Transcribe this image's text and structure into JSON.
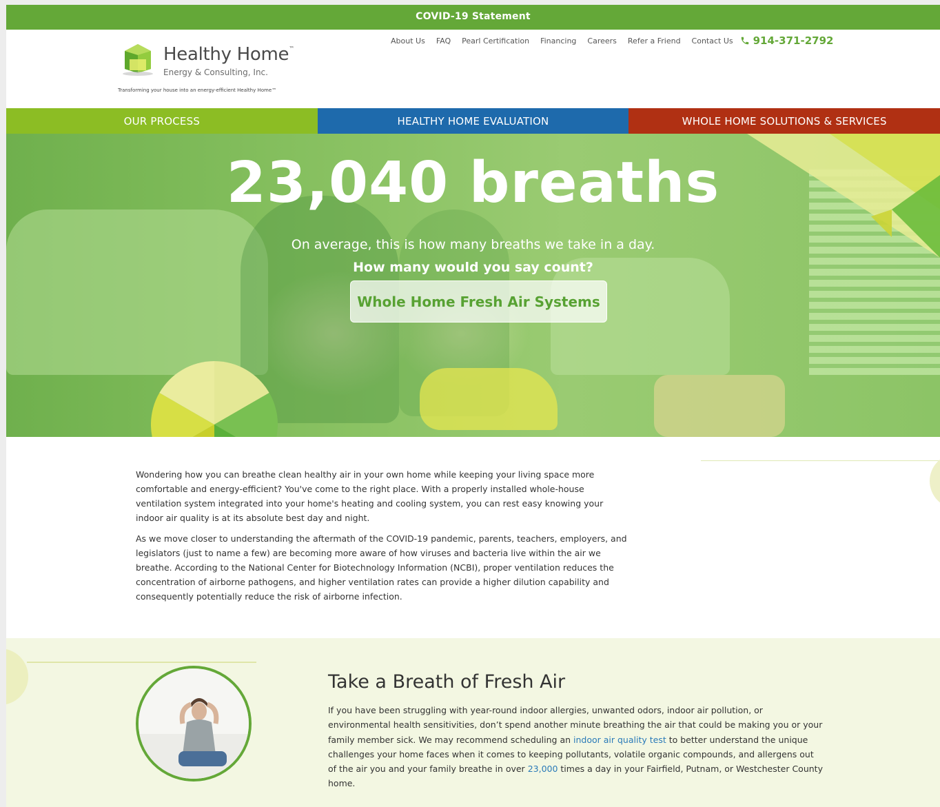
{
  "covid_bar": {
    "label": "COVID-19 Statement"
  },
  "brand": {
    "name": "Healthy Home",
    "tm": "™",
    "subtitle": "Energy & Consulting, Inc.",
    "tagline": "Transforming your house into an energy-efficient Healthy Home™"
  },
  "topnav": {
    "items": [
      "About Us",
      "FAQ",
      "Pearl Certification",
      "Financing",
      "Careers",
      "Refer a Friend",
      "Contact Us"
    ],
    "phone": "914-371-2792"
  },
  "mainnav": {
    "items": [
      "OUR PROCESS",
      "HEALTHY HOME EVALUATION",
      "WHOLE HOME SOLUTIONS & SERVICES"
    ]
  },
  "hero": {
    "title": "23,040 breaths",
    "subtitle": "On average, this is how many breaths we take in a day.",
    "subtitle_bold": "How many would you say count?",
    "cta": "Whole Home Fresh Air Systems"
  },
  "intro": {
    "p1": "Wondering how you can breathe clean healthy air in your own home while keeping your living space more comfortable and energy-efficient? You've come to the right place. With a properly installed whole-house ventilation system integrated into your home's heating and cooling system, you can rest easy knowing your indoor air quality is at its absolute best day and night.",
    "p2": "As we move closer to understanding the aftermath of the COVID-19 pandemic, parents, teachers, employers, and legislators (just to name a few) are becoming more aware of how viruses and bacteria live within the air we breathe. According to the National Center for Biotechnology Information (NCBI), proper ventilation reduces the concentration of airborne pathogens, and higher ventilation rates can provide a higher dilution capability and consequently potentially reduce the risk of airborne infection."
  },
  "fresh": {
    "heading": "Take a Breath of Fresh Air",
    "part1": "If you have been struggling with year-round indoor allergies, unwanted odors, indoor air pollution, or environmental health sensitivities, don’t spend another minute breathing the air that could be making you or your family member sick. We may recommend scheduling an ",
    "link1": "indoor air quality test",
    "part2": " to better understand the unique challenges your home faces when it comes to keeping pollutants, volatile organic compounds, and allergens out of the air you and your family breathe in over ",
    "link2": "23,000",
    "part3": " times a day in your Fairfield, Putnam, or Westchester County home."
  },
  "colors": {
    "green": "#64a838",
    "nav_green": "#8cbd24",
    "nav_blue": "#1e6aac",
    "nav_red": "#b03013",
    "link_blue": "#2a7ab8"
  },
  "icons": [
    "phone-icon",
    "house-logo-icon"
  ]
}
